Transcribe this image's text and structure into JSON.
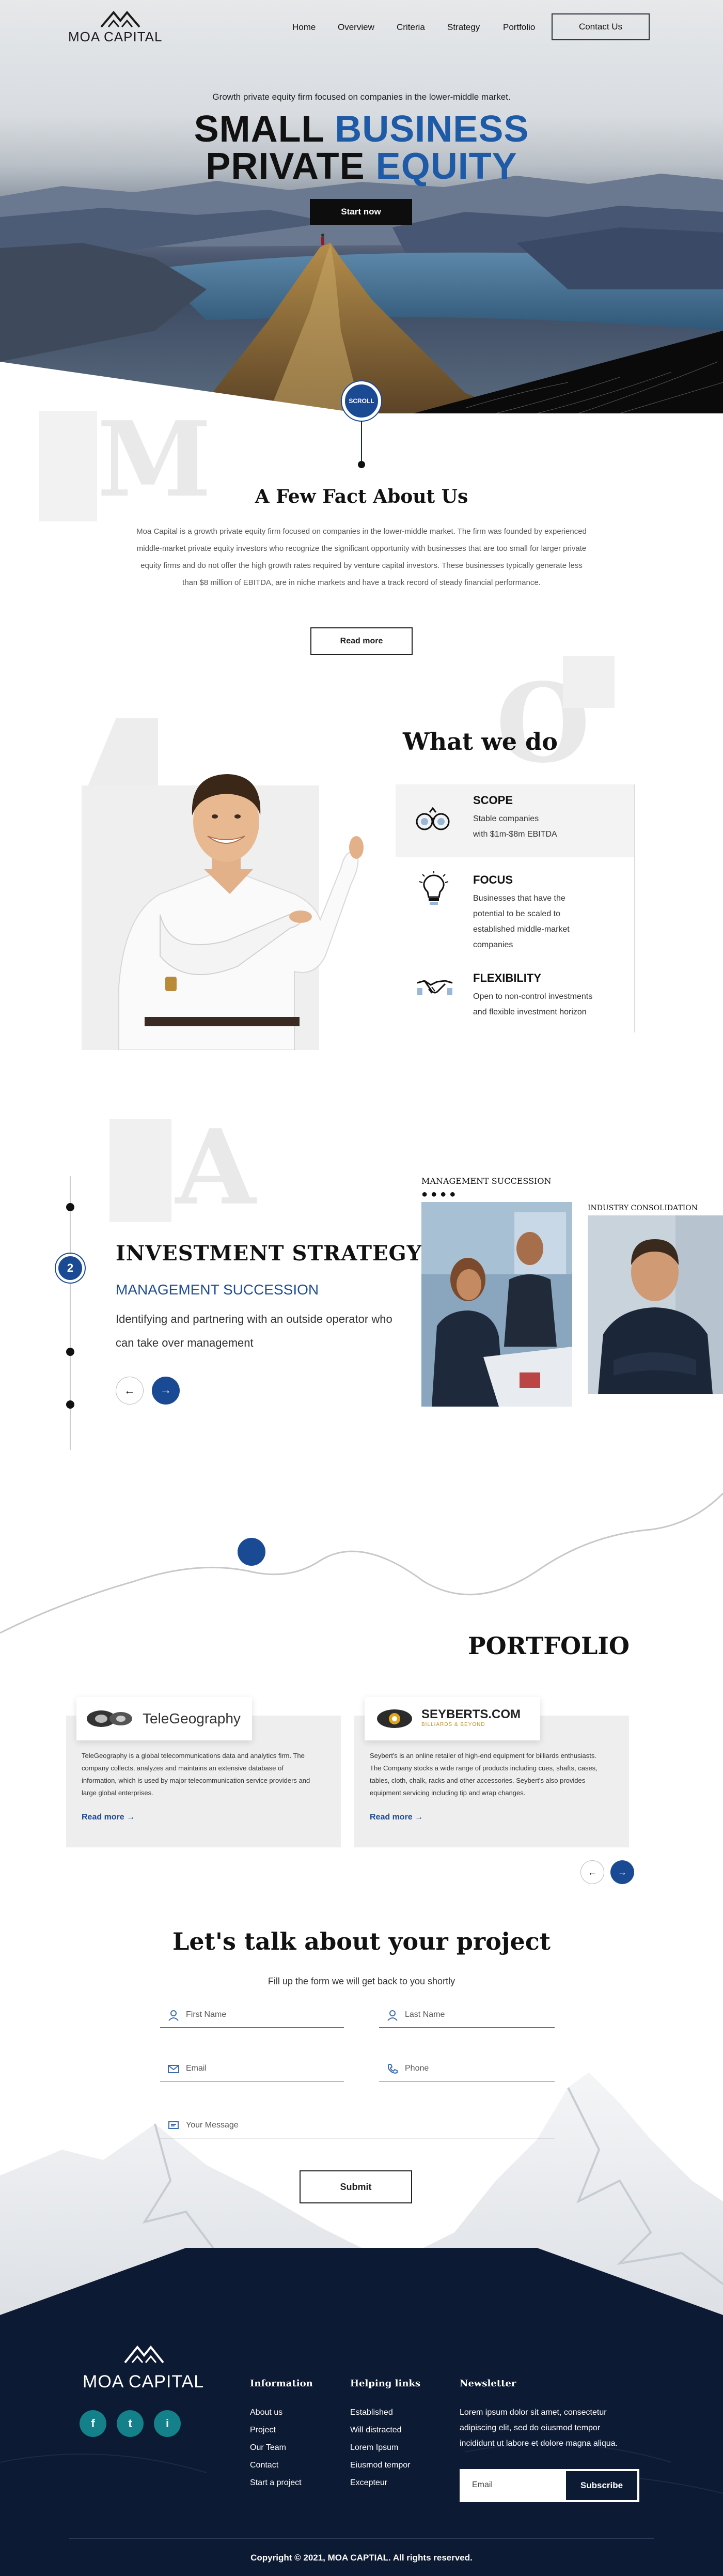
{
  "nav": {
    "logo": "MOA CAPITAL",
    "links": [
      "Home",
      "Overview",
      "Criteria",
      "Strategy",
      "Portfolio"
    ],
    "contact": "Contact Us"
  },
  "hero": {
    "subtitle": "Growth private equity firm focused on companies in the lower-middle market.",
    "line1_dark": "SMALL",
    "line1_blue": "BUSINESS",
    "line2_dark": "PRIVATE",
    "line2_blue": "EQUITY",
    "cta": "Start now",
    "scroll": "SCROLL"
  },
  "facts": {
    "letter": "M",
    "title": "A Few Fact About Us",
    "body": "Moa Capital is a growth private equity firm focused on companies in the lower-middle market. The firm was founded by experienced middle-market private equity investors who recognize the significant opportunity with businesses that are too small for larger private equity firms and do not offer the high growth rates required by venture capital investors. These businesses typically generate less than $8 million of EBITDA, are in niche markets and have a track record of steady financial performance.",
    "button": "Read more"
  },
  "what_we_do": {
    "letter": "O",
    "title": "What we do",
    "items": [
      {
        "icon": "binoculars-icon",
        "title": "SCOPE",
        "lines": [
          "Stable companies",
          "with $1m-$8m EBITDA"
        ]
      },
      {
        "icon": "lightbulb-icon",
        "title": "FOCUS",
        "lines": [
          "Businesses that have the",
          "potential to be scaled to",
          "established middle-market",
          "companies"
        ]
      },
      {
        "icon": "handshake-icon",
        "title": "FLEXIBILITY",
        "lines": [
          "Open to non-control investments",
          "and flexible investment horizon"
        ]
      }
    ]
  },
  "strategy": {
    "letter": "A",
    "step": "2",
    "title": "INVESTMENT STRATEGY",
    "subtitle": "MANAGEMENT SUCCESSION",
    "text": "Identifying and partnering with an outside operator who can take over management",
    "card1_label": "MANAGEMENT SUCCESSION",
    "card2_label": "INDUSTRY CONSOLIDATION"
  },
  "portfolio": {
    "title": "PORTFOLIO",
    "cards": [
      {
        "logo": "TeleGeography",
        "text": "TeleGeography is a global telecommunications data and analytics firm. The company collects, analyzes and maintains an extensive database of information, which is used by major telecommunication service providers and large global enterprises.",
        "link": "Read more"
      },
      {
        "logo": "SEYBERTS.COM",
        "logo_tag": "BILLIARDS & BEYOND",
        "text": "Seybert's is an online retailer of high-end equipment for billiards enthusiasts. The Company stocks a wide range of products including cues, shafts, cases, tables, cloth, chalk, racks and other accessories. Seybert's also provides equipment servicing including tip and wrap changes.",
        "link": "Read more"
      }
    ]
  },
  "contact": {
    "title": "Let's talk about your project",
    "subtitle": "Fill up the form we will get back to you shortly",
    "first_name": "First Name",
    "last_name": "Last Name",
    "email": "Email",
    "phone": "Phone",
    "message": "Your Message",
    "submit": "Submit"
  },
  "footer": {
    "logo": "MOA CAPITAL",
    "social": [
      "f",
      "t",
      "i"
    ],
    "information": {
      "title": "Information",
      "links": [
        "About us",
        "Project",
        "Our Team",
        "Contact",
        "Start a project"
      ]
    },
    "helping": {
      "title": "Helping links",
      "links": [
        "Established",
        "Will distracted",
        "Lorem Ipsum",
        "Eiusmod tempor",
        "Excepteur"
      ]
    },
    "newsletter": {
      "title": "Newsletter",
      "text": "Lorem ipsum dolor sit amet, consectetur adipiscing elit, sed do eiusmod tempor incididunt ut labore et dolore magna aliqua.",
      "placeholder": "Email",
      "button": "Subscribe"
    },
    "copyright": "Copyright © 2021, MOA CAPTIAL. All rights reserved."
  },
  "colors": {
    "accent": "#1e5aa6",
    "navy": "#0d1a33",
    "teal": "#13808a"
  }
}
